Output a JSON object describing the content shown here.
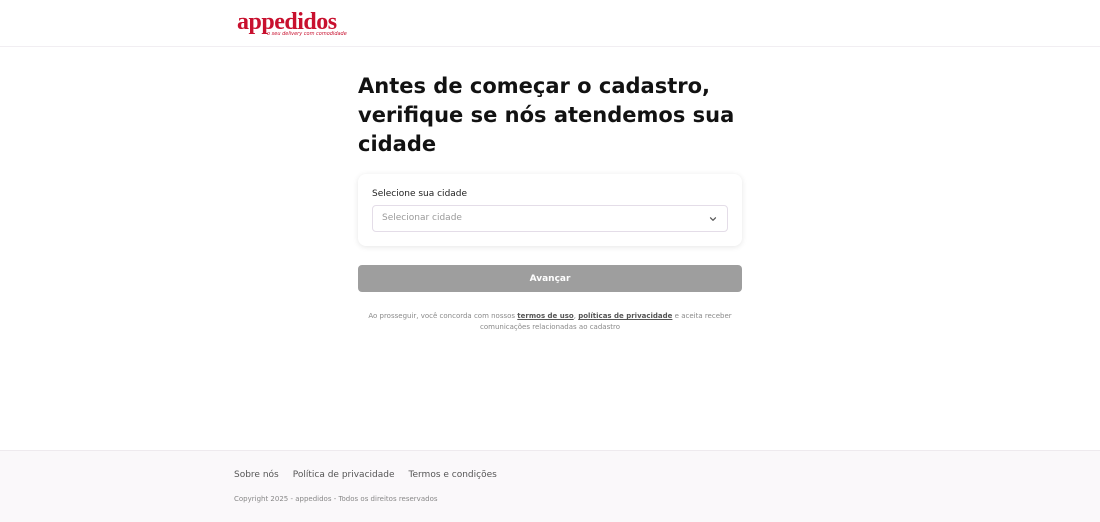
{
  "brand": {
    "name": "appedidos",
    "tagline": "o seu delivery com comodidade",
    "color": "#c8102e"
  },
  "main": {
    "title": "Antes de começar o cadastro, verifique se nós atendemos sua cidade",
    "city_label": "Selecione sua cidade",
    "city_placeholder": "Selecionar cidade",
    "submit_label": "Avançar",
    "legal": {
      "prefix": "Ao prosseguir, você concorda com nossos",
      "terms_link": "termos de uso",
      "separator": ",",
      "privacy_link": "políticas de privacidade",
      "suffix": "e aceita receber comunicações relacionadas ao cadastro"
    }
  },
  "footer": {
    "links": [
      "Sobre nós",
      "Política de privacidade",
      "Termos e condições"
    ],
    "copyright": "Copyright 2025 - appedidos - Todos os direitos reservados"
  }
}
